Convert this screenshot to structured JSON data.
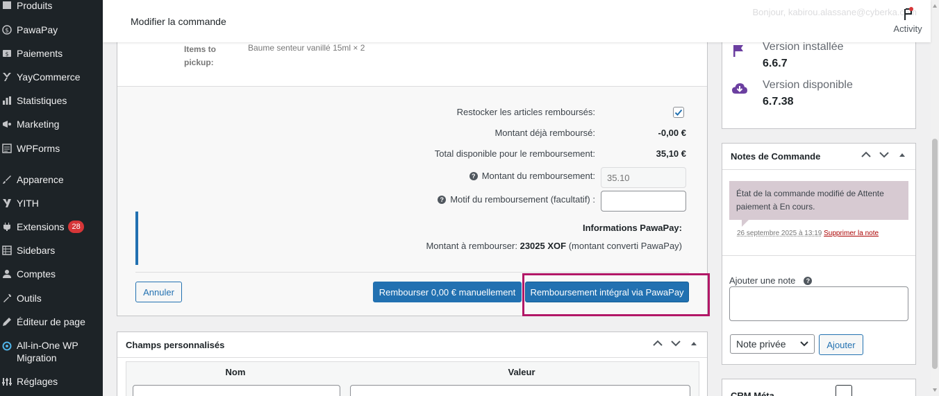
{
  "sidebar": {
    "items": [
      {
        "label": "Produits",
        "icon": "box-icon"
      },
      {
        "label": "PawaPay",
        "icon": "dollar-icon"
      },
      {
        "label": "Paiements",
        "icon": "payment-icon"
      },
      {
        "label": "YayCommerce",
        "icon": "yaycommerce-icon"
      },
      {
        "label": "Statistiques",
        "icon": "chart-icon"
      },
      {
        "label": "Marketing",
        "icon": "megaphone-icon"
      },
      {
        "label": "WPForms",
        "icon": "form-icon"
      },
      {
        "label": "Apparence",
        "icon": "brush-icon"
      },
      {
        "label": "YITH",
        "icon": "yith-icon"
      },
      {
        "label": "Extensions",
        "icon": "plugin-icon",
        "badge": "28"
      },
      {
        "label": "Sidebars",
        "icon": "grid-icon"
      },
      {
        "label": "Comptes",
        "icon": "user-icon"
      },
      {
        "label": "Outils",
        "icon": "wrench-icon"
      },
      {
        "label": "Éditeur de page",
        "icon": "pencil-icon"
      },
      {
        "label": "All-in-One WP Migration",
        "icon": "migration-icon"
      },
      {
        "label": "Réglages",
        "icon": "settings-icon"
      }
    ]
  },
  "header": {
    "title": "Modifier la commande",
    "greeting": "Bonjour, kabirou.alassane@cyberka.com",
    "activity_label": "Activity"
  },
  "order": {
    "pickup_label": "Items to pickup:",
    "pickup_value": "Baume senteur vanillé 15ml × 2"
  },
  "refund": {
    "restock_label": "Restocker les articles remboursés:",
    "restock_checked": true,
    "already_refunded_label": "Montant déjà remboursé:",
    "already_refunded_value": "-0,00 €",
    "available_label": "Total disponible pour le remboursement:",
    "available_value": "35,10 €",
    "amount_label": "Montant du remboursement:",
    "amount_placeholder": "35.10",
    "reason_label": "Motif du remboursement (facultatif) :",
    "pawapay_title": "Informations PawaPay:",
    "pawapay_prefix": "Montant à rembourser: ",
    "pawapay_amount": "23025 XOF",
    "pawapay_suffix": " (montant converti PawaPay)",
    "cancel_label": "Annuler",
    "manual_label": "Rembourser 0,00 € manuellement",
    "pawapay_button_label": "Remboursement intégral via PawaPay",
    "highlight_color": "#b21767"
  },
  "custom_fields": {
    "title": "Champs personnalisés",
    "col_name": "Nom",
    "col_value": "Valeur"
  },
  "version": {
    "installed_label": "Version installée",
    "installed_value": "6.6.7",
    "available_label": "Version disponible",
    "available_value": "6.7.38",
    "accent": "#6b3fa0"
  },
  "notes": {
    "title": "Notes de Commande",
    "note_text": "État de la commande modifié de Attente paiement à En cours.",
    "note_date": "26 septembre 2025 à 13:19",
    "note_delete": "Supprimer la note",
    "add_label": "Ajouter une note",
    "type_selected": "Note privée",
    "add_button": "Ajouter"
  },
  "next_box": {
    "title": "CRM Méta"
  },
  "colors": {
    "primary": "#2271b1",
    "sidebar_bg": "#1d2327",
    "note_bg": "#d7cad2"
  }
}
